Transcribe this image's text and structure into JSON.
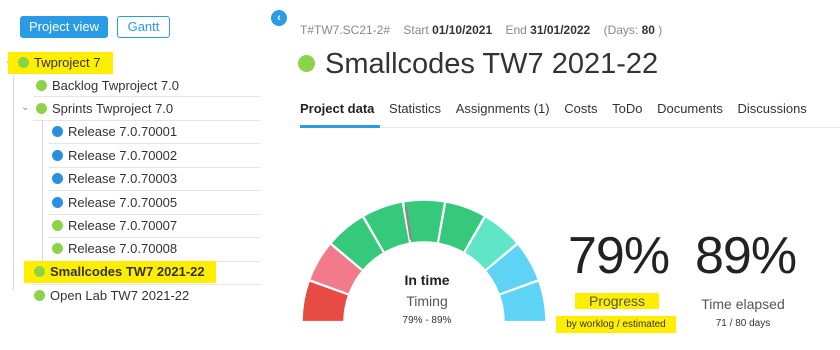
{
  "toolbar": {
    "project_view_label": "Project view",
    "gantt_label": "Gantt"
  },
  "tree": [
    {
      "label": "Twproject 7",
      "color": "#8bd448"
    },
    {
      "label": "Backlog Twproject 7.0",
      "color": "#8bd448"
    },
    {
      "label": "Sprints Twproject 7.0",
      "color": "#8bd448"
    },
    {
      "label": "Release 7.0.70001",
      "color": "#2a8fe0"
    },
    {
      "label": "Release 7.0.70002",
      "color": "#2a8fe0"
    },
    {
      "label": "Release 7.0.70003",
      "color": "#2a8fe0"
    },
    {
      "label": "Release 7.0.70005",
      "color": "#2a8fe0"
    },
    {
      "label": "Release 7.0.70007",
      "color": "#8bd448"
    },
    {
      "label": "Release 7.0.70008",
      "color": "#8bd448"
    },
    {
      "label": "Smallcodes TW7 2021-22",
      "color": "#8bd448"
    },
    {
      "label": "Open Lab TW7 2021-22",
      "color": "#8bd448"
    }
  ],
  "header": {
    "code": "T#TW7.SC21-2#",
    "start_label": "Start",
    "start_value": "01/10/2021",
    "end_label": "End",
    "end_value": "31/01/2022",
    "days_prefix": "(Days:",
    "days_value": "80",
    "days_suffix": ")",
    "title": "Smallcodes TW7 2021-22"
  },
  "tabs": [
    "Project data",
    "Statistics",
    "Assignments (1)",
    "Costs",
    "ToDo",
    "Documents",
    "Discussions"
  ],
  "gauge": {
    "status": "In time",
    "label": "Timing",
    "range": "79% - 89%",
    "needle_value": 0.45,
    "segment_colors": [
      "#e84a44",
      "#f27a8a",
      "#36c97c",
      "#36c97c",
      "#36c97c",
      "#36c97c",
      "#5ee6c6",
      "#5fd3f5",
      "#5fd3f5"
    ]
  },
  "progress": {
    "value": "79%",
    "label": "Progress",
    "sublabel": "by worklog / estimated"
  },
  "elapsed": {
    "value": "89%",
    "label": "Time elapsed",
    "sublabel": "71 / 80 days"
  }
}
